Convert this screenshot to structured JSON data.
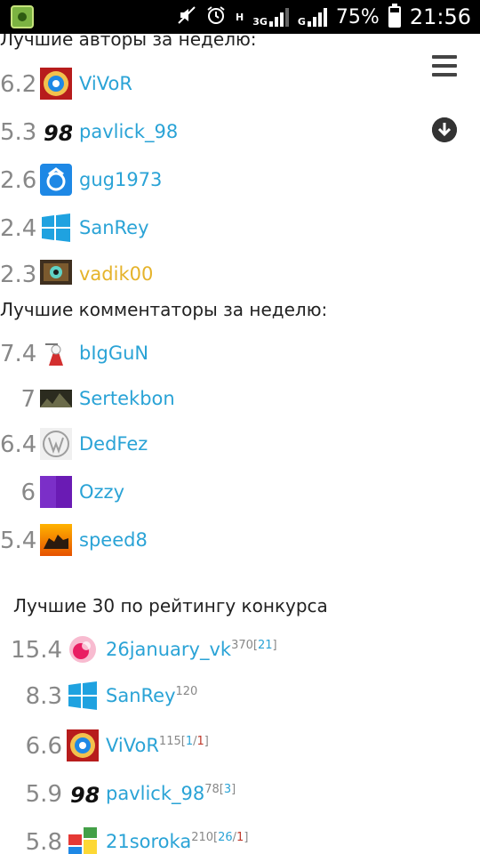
{
  "status_bar": {
    "network_h": "H",
    "network_3g": "3G",
    "network_g": "G",
    "battery_percent": "75%",
    "battery_level": 0.75,
    "time": "21:56"
  },
  "weekly_authors": {
    "title": "Лучшие авторы за неделю:",
    "rows": [
      {
        "score": "6.2",
        "name": "ViVoR",
        "avatar": "vivor-avatar",
        "accent": "#2aa3d6"
      },
      {
        "score": "5.3",
        "name": "pavlick_98",
        "avatar": "pavlick-avatar",
        "accent": "#2aa3d6"
      },
      {
        "score": "2.6",
        "name": "gug1973",
        "avatar": "gug-avatar",
        "accent": "#2aa3d6"
      },
      {
        "score": "2.4",
        "name": "SanRey",
        "avatar": "windows-avatar",
        "accent": "#2aa3d6"
      },
      {
        "score": "2.3",
        "name": "vadik00",
        "avatar": "vadik-avatar",
        "accent": "#e5b32a"
      }
    ]
  },
  "weekly_commenters": {
    "title": "Лучшие комментаторы за неделю:",
    "rows": [
      {
        "score": "7.4",
        "name": "bIgGuN"
      },
      {
        "score": "7",
        "name": "Sertekbon"
      },
      {
        "score": "6.4",
        "name": "DedFez"
      },
      {
        "score": "6",
        "name": "Ozzy"
      },
      {
        "score": "5.4",
        "name": "speed8"
      }
    ]
  },
  "contest_top": {
    "title": "Лучшие 30 по рейтингу конкурса",
    "rows": [
      {
        "score": "15.4",
        "name": "26january_vk",
        "points": "370",
        "extra_open": "[",
        "extra_a": "21",
        "extra_sep": "",
        "extra_b": "",
        "extra_close": "]"
      },
      {
        "score": "8.3",
        "name": "SanRey",
        "points": "120",
        "extra_open": "",
        "extra_a": "",
        "extra_sep": "",
        "extra_b": "",
        "extra_close": ""
      },
      {
        "score": "6.6",
        "name": "ViVoR",
        "points": "115",
        "extra_open": "[",
        "extra_a": "1",
        "extra_sep": "/",
        "extra_b": "1",
        "extra_close": "]"
      },
      {
        "score": "5.9",
        "name": "pavlick_98",
        "points": "78",
        "extra_open": "[",
        "extra_a": "3",
        "extra_sep": "",
        "extra_b": "",
        "extra_close": "]"
      },
      {
        "score": "5.8",
        "name": "21soroka",
        "points": "210",
        "extra_open": "[",
        "extra_a": "26",
        "extra_sep": "/",
        "extra_b": "1",
        "extra_close": "]"
      }
    ]
  },
  "colors": {
    "link": "#2aa3d6",
    "gold": "#e5b32a",
    "score": "#888888"
  }
}
